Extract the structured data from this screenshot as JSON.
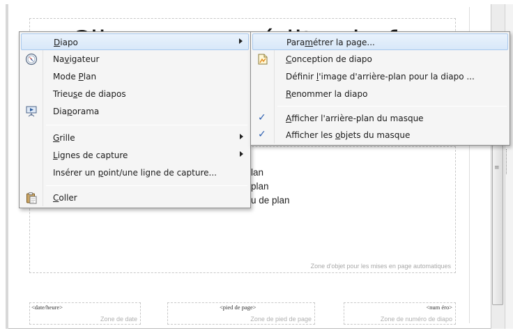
{
  "slide": {
    "title": "Cliquez pour éditer le format du",
    "content_lines": [
      "lan",
      "plan",
      "u de plan"
    ],
    "content_caption": "Zone d'objet pour les mises en page automatiques",
    "footers": [
      {
        "tag": "<date/heure>",
        "zone": "Zone de date"
      },
      {
        "tag": "<pied de page>",
        "zone": "Zone de pied de page"
      },
      {
        "tag": "<num éro>",
        "zone": "Zone de numéro de diapo"
      }
    ]
  },
  "context_menu": {
    "items": [
      {
        "pre": "",
        "ul": "D",
        "post": "iapo",
        "icon": "",
        "submenu": true
      },
      {
        "pre": "Na",
        "ul": "v",
        "post": "igateur",
        "icon": "navigator-icon",
        "submenu": false
      },
      {
        "pre": "Mode ",
        "ul": "P",
        "post": "lan",
        "icon": "",
        "submenu": false
      },
      {
        "pre": "Trieu",
        "ul": "s",
        "post": "e de diapos",
        "icon": "",
        "submenu": false
      },
      {
        "pre": "Dia",
        "ul": "p",
        "post": "orama",
        "icon": "slideshow-icon",
        "submenu": false
      },
      {
        "pre": "",
        "ul": "G",
        "post": "rille",
        "icon": "",
        "submenu": true
      },
      {
        "pre": "",
        "ul": "L",
        "post": "ignes de capture",
        "icon": "",
        "submenu": true
      },
      {
        "pre": "Insérer un ",
        "ul": "p",
        "post": "oint/une ligne de capture...",
        "icon": "",
        "submenu": false
      },
      {
        "pre": "",
        "ul": "C",
        "post": "oller",
        "icon": "paste-icon",
        "submenu": false
      }
    ]
  },
  "submenu": {
    "items": [
      {
        "pre": "Para",
        "ul": "m",
        "post": "étrer la page...",
        "checked": false,
        "icon": ""
      },
      {
        "pre": "",
        "ul": "C",
        "post": "onception de diapo",
        "checked": false,
        "icon": "slide-design-icon"
      },
      {
        "pre": "Définir ",
        "ul": "l",
        "post": "'image d'arrière-plan pour la diapo ...",
        "checked": false,
        "icon": ""
      },
      {
        "pre": "",
        "ul": "R",
        "post": "enommer la diapo",
        "checked": false,
        "icon": ""
      },
      {
        "pre": "",
        "ul": "A",
        "post": "fficher l'arrière-plan du masque",
        "checked": true,
        "icon": ""
      },
      {
        "pre": "Afficher les ",
        "ul": "o",
        "post": "bjets du masque",
        "checked": true,
        "icon": ""
      }
    ]
  },
  "colors": {
    "highlight": "#d8e8f9",
    "highlight_border": "#a9c9ee",
    "check": "#2a5db0"
  }
}
